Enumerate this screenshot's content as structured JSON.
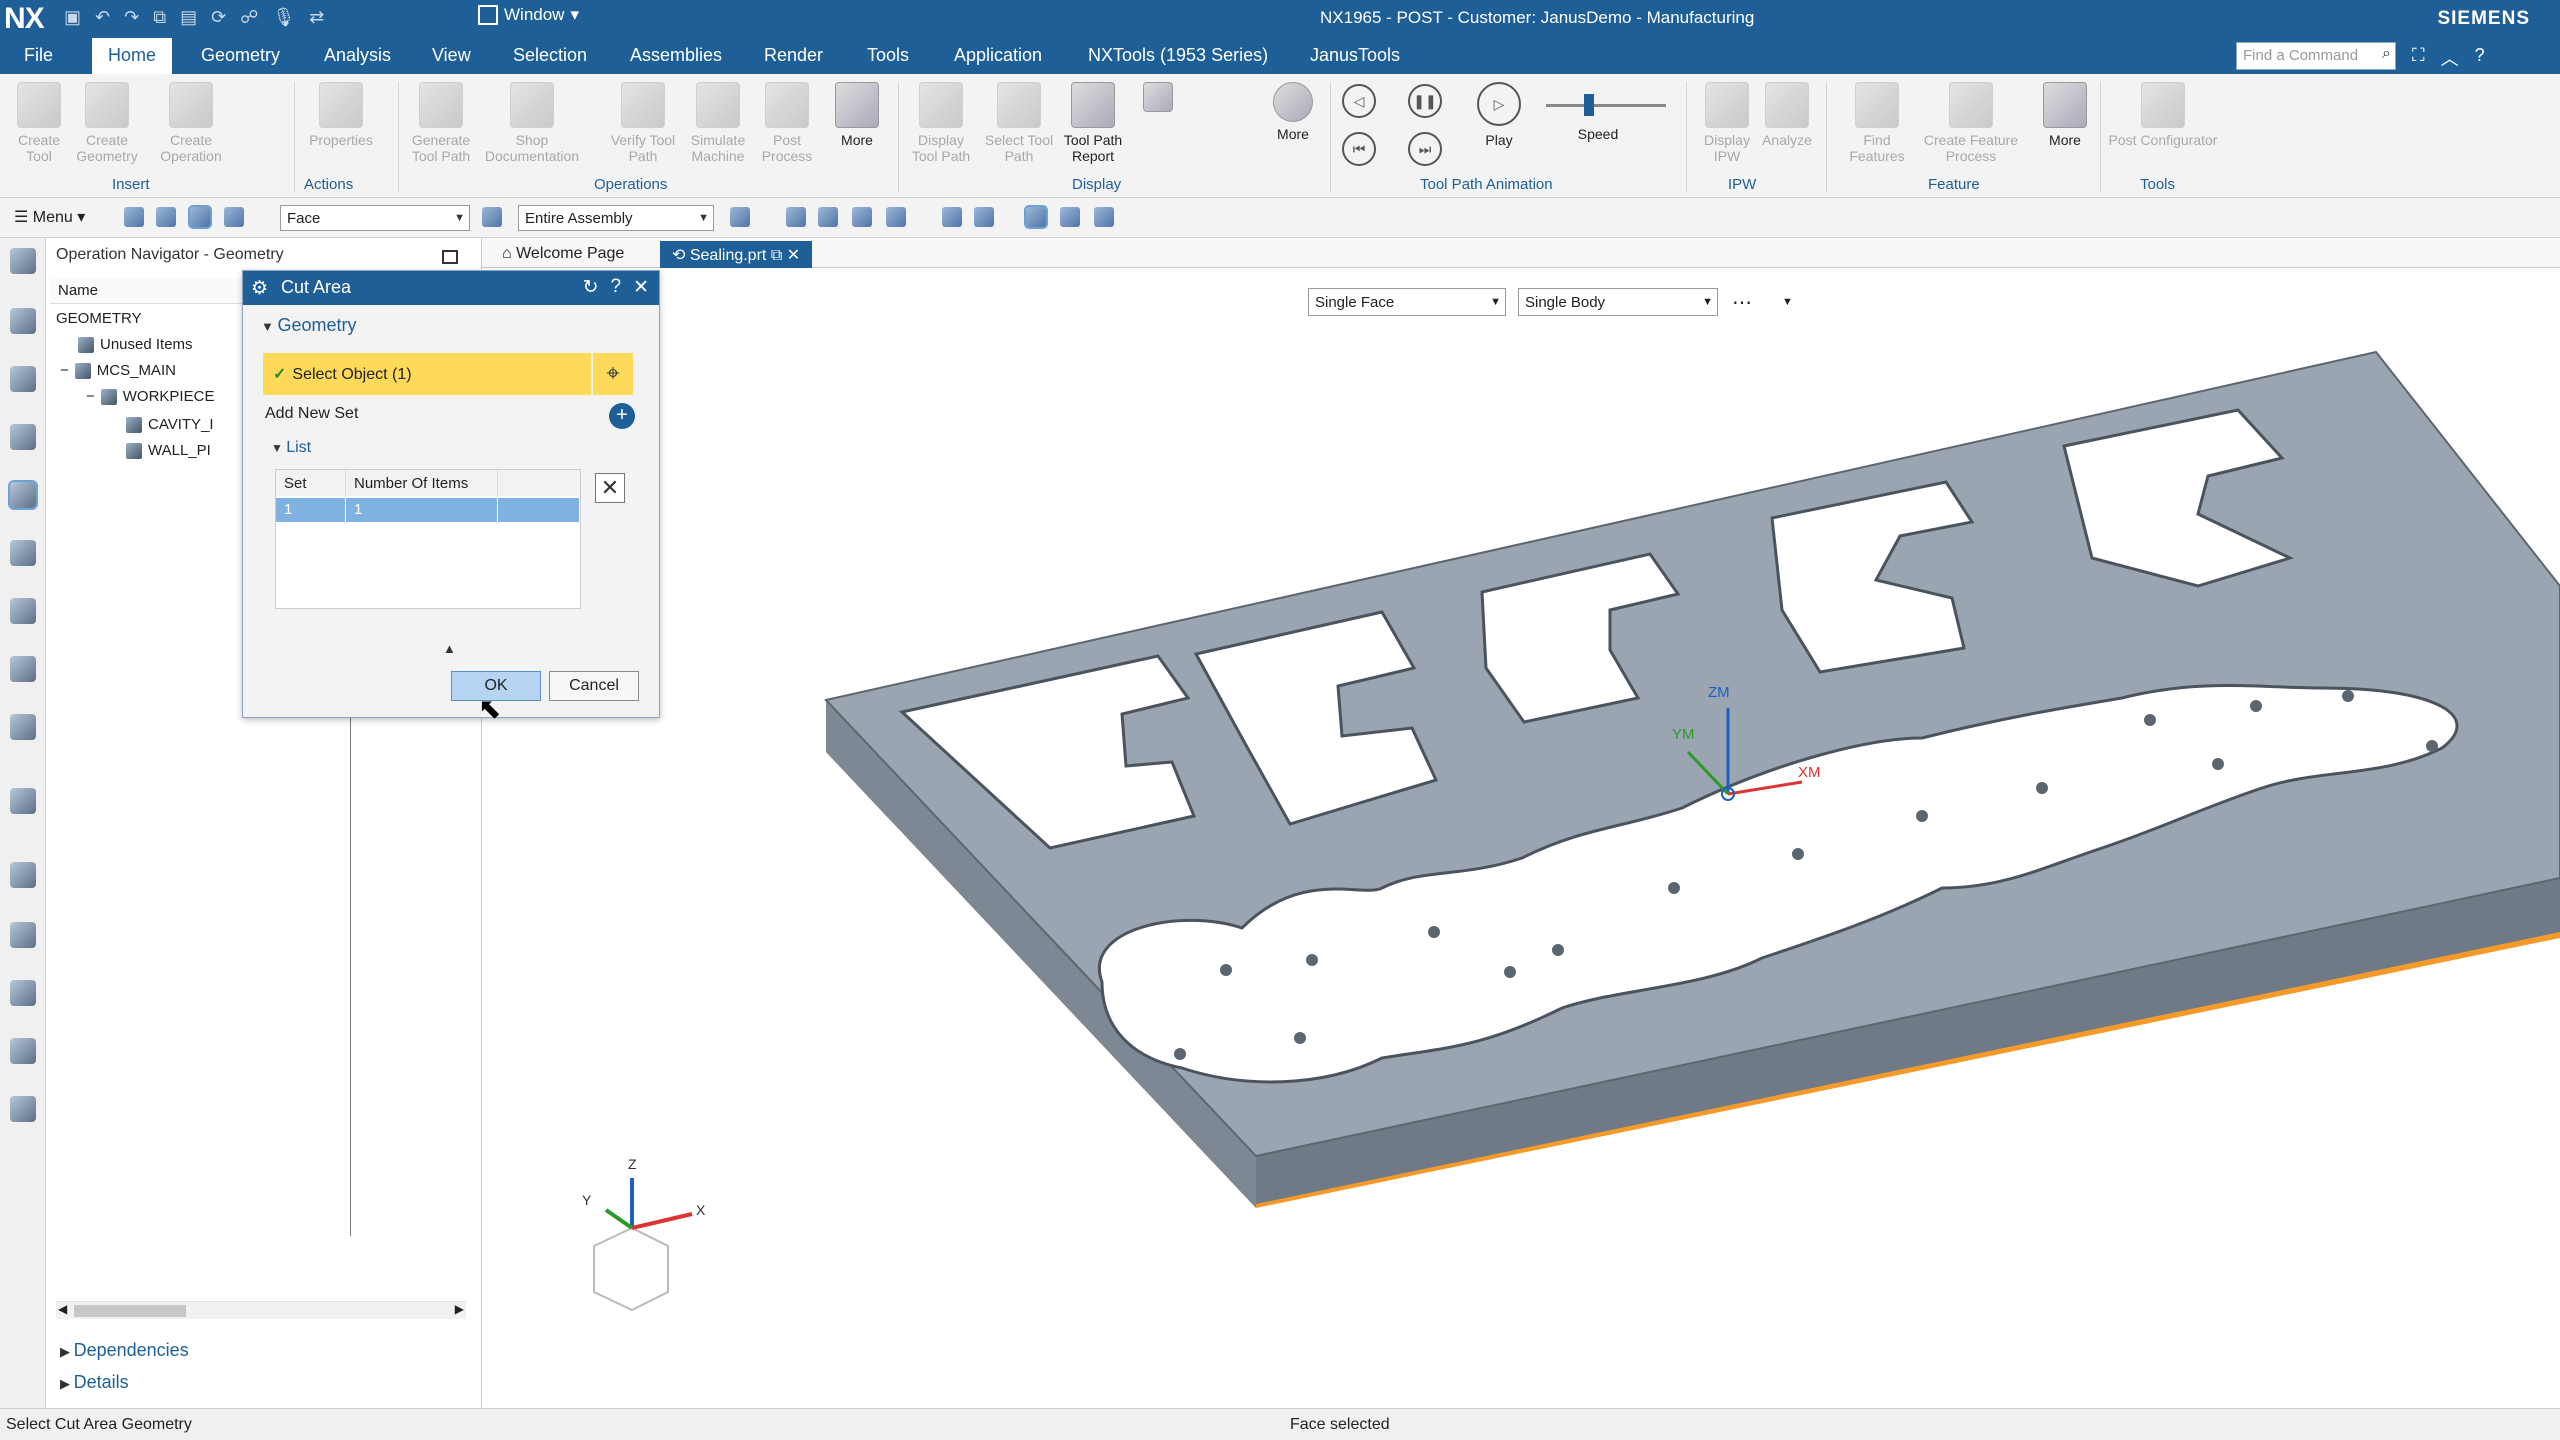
{
  "window": {
    "logo": "NX",
    "window_menu": "Window",
    "title": "NX1965 - POST - Customer: JanusDemo - Manufacturing",
    "brand": "SIEMENS"
  },
  "menu_tabs": [
    "File",
    "Home",
    "Geometry",
    "Analysis",
    "View",
    "Selection",
    "Assemblies",
    "Render",
    "Tools",
    "Application",
    "NXTools (1953 Series)",
    "JanusTools"
  ],
  "active_tab": "Home",
  "command_search": {
    "placeholder": "Find a Command"
  },
  "ribbon": {
    "buttons": {
      "create_tool": "Create Tool",
      "create_geometry": "Create Geometry",
      "create_operation": "Create Operation",
      "properties": "Properties",
      "generate_tool_path": "Generate Tool Path",
      "shop_documentation": "Shop Documentation",
      "verify_tool_path": "Verify Tool Path",
      "simulate_machine": "Simulate Machine",
      "post_process": "Post Process",
      "more_ops": "More",
      "display_tool_path": "Display Tool Path",
      "select_tool_path": "Select Tool Path",
      "tool_path_report": "Tool Path Report",
      "more_display": "More",
      "play": "Play",
      "speed": "Speed",
      "display_ipw": "Display IPW",
      "analyze": "Analyze",
      "find_features": "Find Features",
      "create_feature_process": "Create Feature Process",
      "more_feature": "More",
      "post_configurator": "Post Configurator"
    },
    "groups": {
      "insert": "Insert",
      "actions": "Actions",
      "operations": "Operations",
      "display": "Display",
      "tool_path_animation": "Tool Path Animation",
      "ipw": "IPW",
      "feature": "Feature",
      "tools": "Tools"
    }
  },
  "toolbar": {
    "menu_label": "Menu",
    "type_filter": "Face",
    "scope_filter": "Entire Assembly"
  },
  "navigator": {
    "title": "Operation Navigator - Geometry",
    "column_name": "Name",
    "tree": [
      "GEOMETRY",
      "Unused Items",
      "MCS_MAIN",
      "WORKPIECE",
      "CAVITY_I",
      "WALL_PI"
    ],
    "sections": [
      "Dependencies",
      "Details"
    ]
  },
  "doc_tabs": [
    "Welcome Page",
    "Sealing.prt"
  ],
  "selection_filters": {
    "face_rule": "Single Face",
    "body_rule": "Single Body"
  },
  "dialog": {
    "title": "Cut Area",
    "section_geometry": "Geometry",
    "select_object": "Select Object (1)",
    "add_new_set": "Add New Set",
    "list_label": "List",
    "columns": [
      "Set",
      "Number Of Items"
    ],
    "rows": [
      [
        "1",
        "1"
      ]
    ],
    "ok_label": "OK",
    "cancel_label": "Cancel"
  },
  "csys_labels": {
    "zm": "ZM",
    "ym": "YM",
    "xm": "XM",
    "z": "Z",
    "y": "Y",
    "x": "X"
  },
  "status": {
    "left": "Select Cut Area Geometry",
    "middle": "Face selected"
  },
  "colors": {
    "title_blue": "#1d5f96",
    "highlight_yellow": "#ffd95a",
    "part_gray": "#9aa5b1",
    "part_edge_orange": "#f39a2b"
  }
}
